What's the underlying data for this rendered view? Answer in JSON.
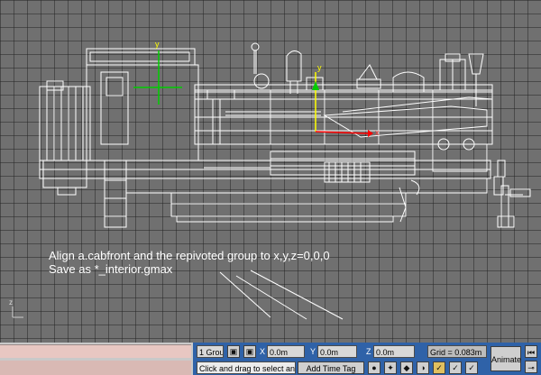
{
  "viewport": {
    "annotation_line1": "Align a.cabfront and the repivoted group to x,y,z=0,0,0",
    "annotation_line2": "Save as *_interior.gmax",
    "axis_x_label": "x",
    "axis_y_label": "y",
    "axis_z_label": "z"
  },
  "status_bar": {
    "selection": "1 Grou",
    "x_label": "X",
    "x_value": "0.0m",
    "y_label": "Y",
    "y_value": "0.0m",
    "z_label": "Z",
    "z_value": "0.0m",
    "grid_readout": "Grid = 0.083m",
    "animate_label": "Animate",
    "prompt": "Click and drag to select and m",
    "add_time_tag": "Add Time Tag"
  },
  "colors": {
    "viewport_bg": "#707070",
    "wireframe": "#ffffff",
    "status_bg": "#2f62a8",
    "x_axis": "#ff0000",
    "y_axis": "#00cc00"
  }
}
